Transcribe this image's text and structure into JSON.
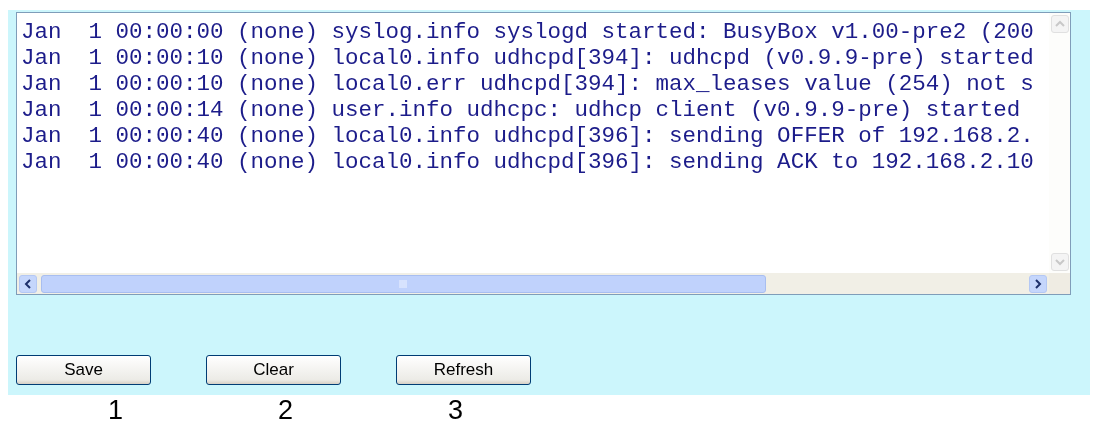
{
  "log": {
    "lines": [
      "Jan  1 00:00:00 (none) syslog.info syslogd started: BusyBox v1.00-pre2 (200",
      "Jan  1 00:00:10 (none) local0.info udhcpd[394]: udhcpd (v0.9.9-pre) started",
      "Jan  1 00:00:10 (none) local0.err udhcpd[394]: max_leases value (254) not s",
      "Jan  1 00:00:14 (none) user.info udhcpc: udhcp client (v0.9.9-pre) started",
      "Jan  1 00:00:40 (none) local0.info udhcpd[396]: sending OFFER of 192.168.2.",
      "Jan  1 00:00:40 (none) local0.info udhcpd[396]: sending ACK to 192.168.2.10"
    ]
  },
  "buttons": [
    "Save",
    "Clear",
    "Refresh"
  ],
  "markers": [
    "1",
    "2",
    "3"
  ]
}
